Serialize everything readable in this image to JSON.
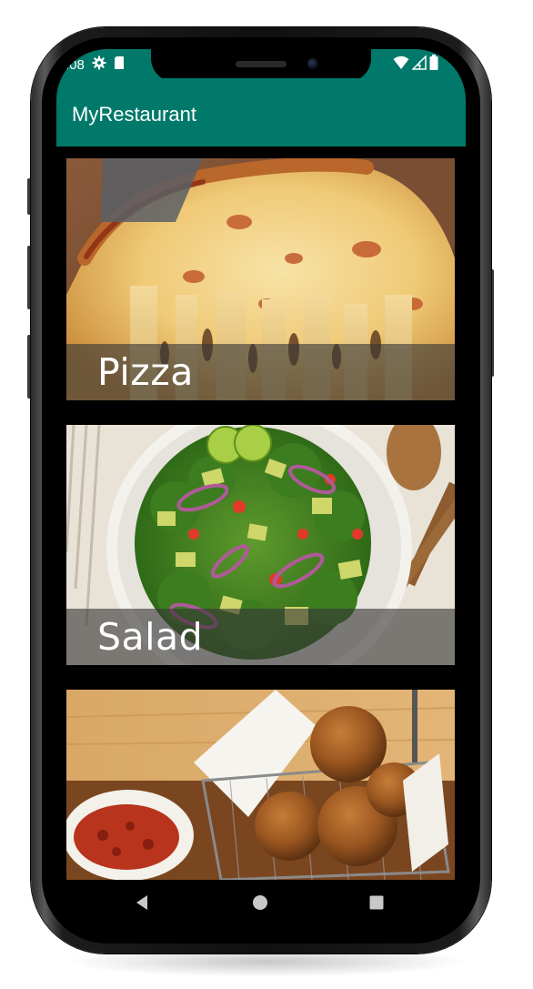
{
  "status_bar": {
    "time": ":08",
    "left_icons": [
      "gear-icon",
      "sd-card-icon"
    ],
    "right_icons": [
      "wifi-icon",
      "signal-icon",
      "battery-icon"
    ]
  },
  "app_bar": {
    "title": "MyRestaurant"
  },
  "menu": {
    "items": [
      {
        "label": "Pizza",
        "image": "pizza-photo"
      },
      {
        "label": "Salad",
        "image": "salad-photo"
      },
      {
        "label": "",
        "image": "croquettes-photo"
      }
    ]
  },
  "nav_bar": {
    "buttons": [
      "back-icon",
      "home-icon",
      "recents-icon"
    ]
  },
  "colors": {
    "app_bar": "#00796b",
    "caption_band": "rgba(55,55,55,0.62)",
    "caption_text": "#ffffff"
  }
}
